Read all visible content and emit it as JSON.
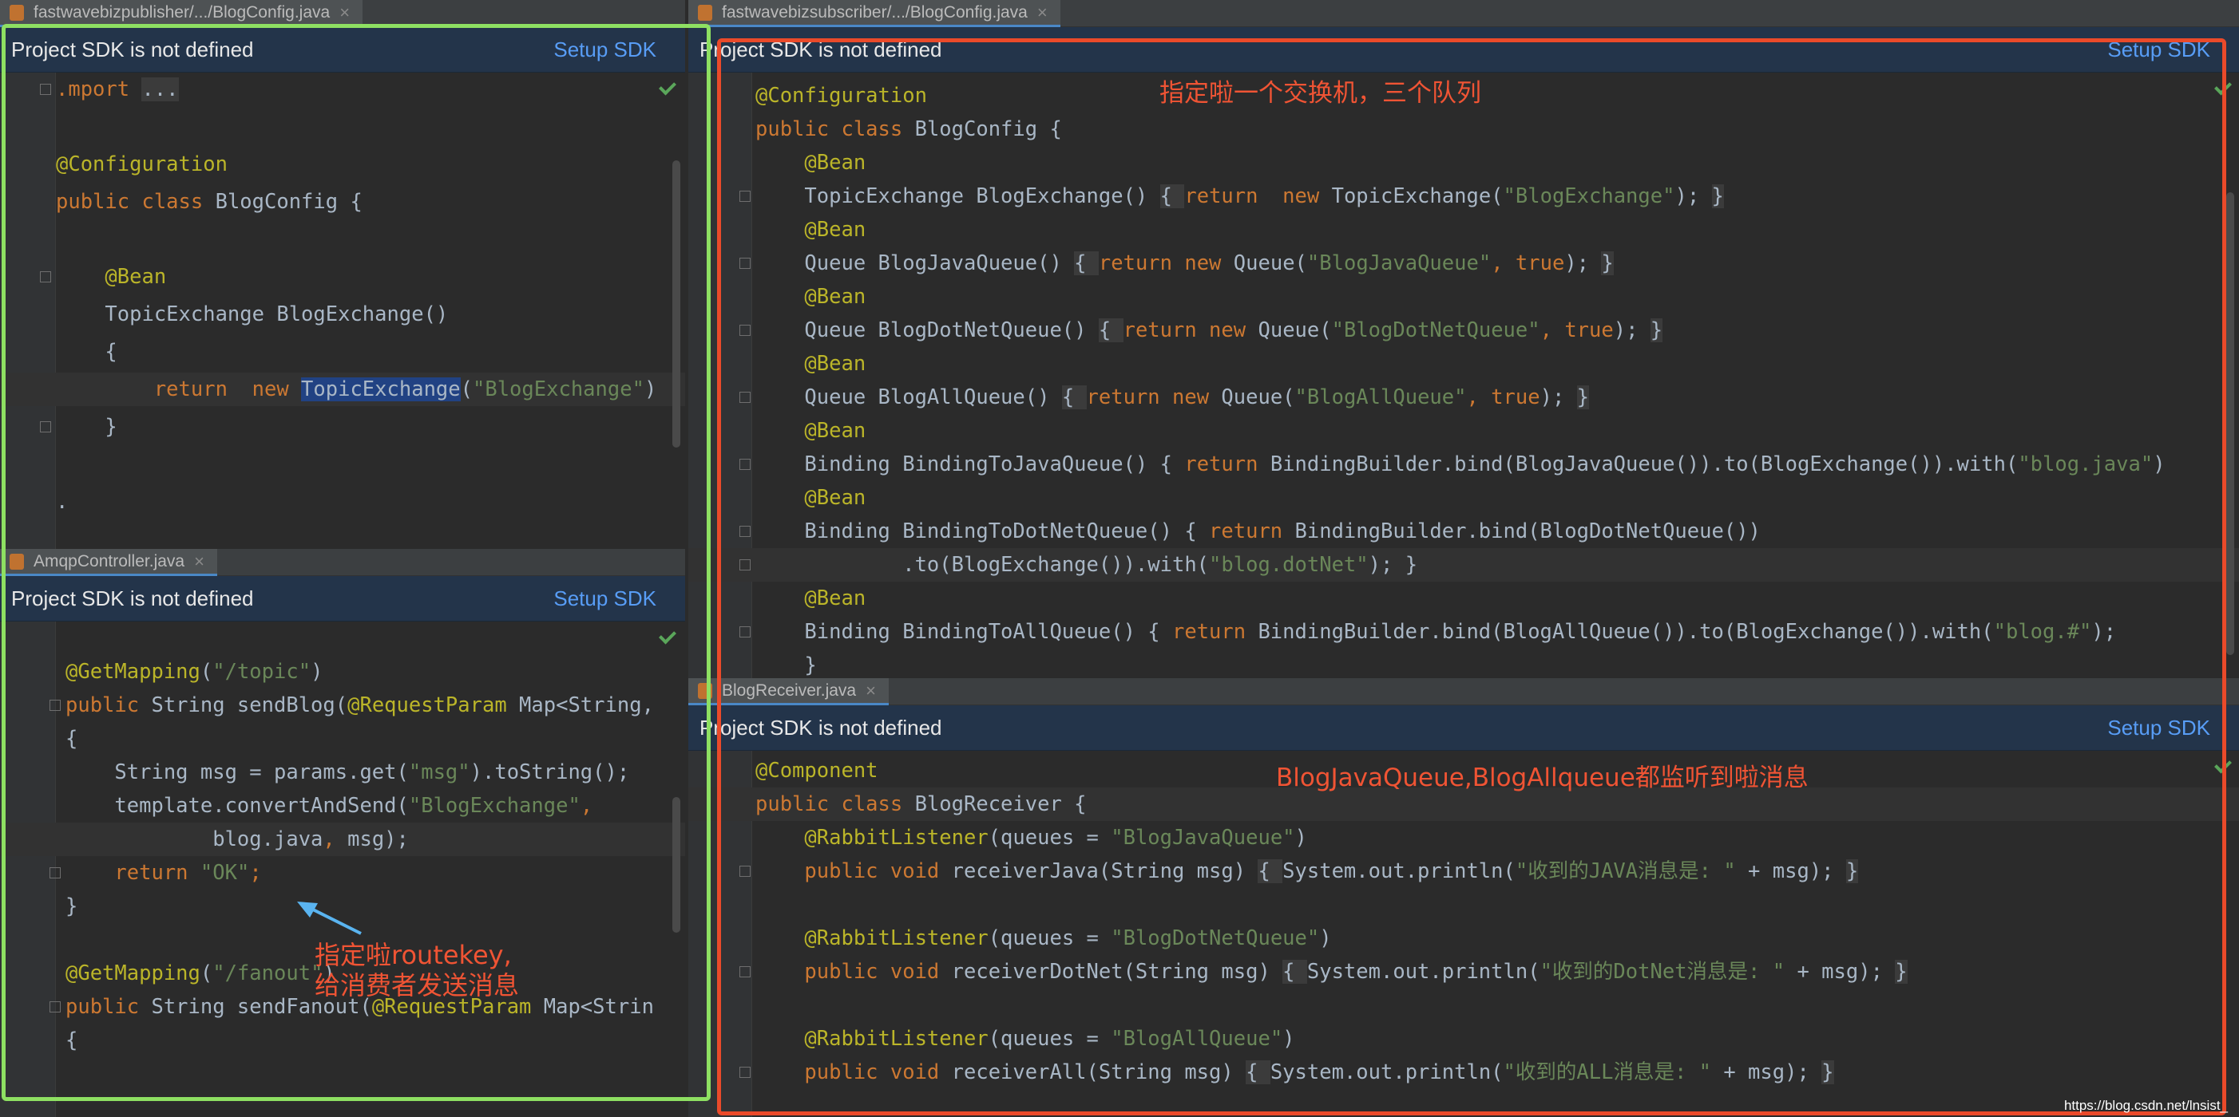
{
  "banner": {
    "message": "Project SDK is not defined",
    "action": "Setup SDK"
  },
  "panes": {
    "top_left": {
      "tab": "fastwavebizpublisher/.../BlogConfig.java",
      "lines": [
        {
          "t": [
            [
              "kw",
              ".mport "
            ],
            [
              "fb",
              "..."
            ]
          ]
        },
        {
          "t": []
        },
        {
          "t": [
            [
              "an",
              "@Configuration"
            ]
          ]
        },
        {
          "t": [
            [
              "kw",
              "public class "
            ],
            [
              "",
              "BlogConfig {"
            ]
          ]
        },
        {
          "t": []
        },
        {
          "t": [
            [
              "an",
              "    @Bean"
            ]
          ]
        },
        {
          "t": [
            [
              "",
              "    TopicExchange BlogExchange()"
            ]
          ]
        },
        {
          "t": [
            [
              "",
              "    {"
            ]
          ]
        },
        {
          "t": [
            [
              "kw",
              "        return  new "
            ],
            [
              "hl",
              "TopicExchange"
            ],
            [
              "",
              "("
            ],
            [
              "st",
              "\"BlogExchange\""
            ],
            [
              "",
              ")"
            ]
          ],
          "cur": true
        },
        {
          "t": [
            [
              "",
              "    }"
            ]
          ]
        },
        {
          "t": []
        },
        {
          "t": [
            [
              "",
              "."
            ]
          ]
        }
      ]
    },
    "bottom_left": {
      "tab": "AmqpController.java",
      "lines": [
        {
          "t": []
        },
        {
          "t": [
            [
              "an",
              "@GetMapping"
            ],
            [
              "",
              "("
            ],
            [
              "st",
              "\"/topic\""
            ],
            [
              "",
              ")"
            ]
          ]
        },
        {
          "t": [
            [
              "kw",
              "public "
            ],
            [
              "",
              "String sendBlog("
            ],
            [
              "an",
              "@RequestParam "
            ],
            [
              "",
              "Map<String,"
            ]
          ]
        },
        {
          "t": [
            [
              "",
              "{"
            ]
          ]
        },
        {
          "t": [
            [
              "",
              "    String msg = params.get("
            ],
            [
              "st",
              "\"msg\""
            ],
            [
              "",
              ").toString();"
            ]
          ]
        },
        {
          "t": [
            [
              "",
              "    template.convertAndSend("
            ],
            [
              "st",
              "\"BlogExchange\""
            ],
            [
              "kw",
              ","
            ]
          ]
        },
        {
          "t": [
            [
              "",
              "            blog.java"
            ],
            [
              "kw",
              ", "
            ],
            [
              "",
              "msg);"
            ]
          ],
          "cur": true
        },
        {
          "t": [
            [
              "kw",
              "    return "
            ],
            [
              "st",
              "\"OK\""
            ],
            [
              "kw",
              ";"
            ]
          ]
        },
        {
          "t": [
            [
              "",
              "}"
            ]
          ]
        },
        {
          "t": []
        },
        {
          "t": [
            [
              "an",
              "@GetMapping"
            ],
            [
              "",
              "("
            ],
            [
              "st",
              "\"/fanout\""
            ],
            [
              "",
              ")"
            ]
          ]
        },
        {
          "t": [
            [
              "kw",
              "public "
            ],
            [
              "",
              "String sendFanout("
            ],
            [
              "an",
              "@RequestParam "
            ],
            [
              "",
              "Map<Strin"
            ]
          ]
        },
        {
          "t": [
            [
              "",
              "{"
            ]
          ]
        }
      ]
    },
    "top_right": {
      "tab": "fastwavebizsubscriber/.../BlogConfig.java",
      "lines": [
        {
          "t": [
            [
              "an",
              "@Configuration"
            ]
          ]
        },
        {
          "t": [
            [
              "kw",
              "public class "
            ],
            [
              "",
              "BlogConfig {"
            ]
          ]
        },
        {
          "t": [
            [
              "an",
              "    @Bean"
            ]
          ]
        },
        {
          "t": [
            [
              "",
              "    TopicExchange BlogExchange() "
            ],
            [
              "fb",
              "{ "
            ],
            [
              "kw",
              "return  new "
            ],
            [
              "",
              "TopicExchange("
            ],
            [
              "st",
              "\"BlogExchange\""
            ],
            [
              "",
              "); "
            ],
            [
              "fb",
              "}"
            ]
          ]
        },
        {
          "t": [
            [
              "an",
              "    @Bean"
            ]
          ]
        },
        {
          "t": [
            [
              "",
              "    Queue BlogJavaQueue() "
            ],
            [
              "fb",
              "{ "
            ],
            [
              "kw",
              "return new "
            ],
            [
              "",
              "Queue("
            ],
            [
              "st",
              "\"BlogJavaQueue\""
            ],
            [
              "kw",
              ", true"
            ],
            [
              "",
              "); "
            ],
            [
              "fb",
              "}"
            ]
          ]
        },
        {
          "t": [
            [
              "an",
              "    @Bean"
            ]
          ]
        },
        {
          "t": [
            [
              "",
              "    Queue BlogDotNetQueue() "
            ],
            [
              "fb",
              "{ "
            ],
            [
              "kw",
              "return new "
            ],
            [
              "",
              "Queue("
            ],
            [
              "st",
              "\"BlogDotNetQueue\""
            ],
            [
              "kw",
              ", true"
            ],
            [
              "",
              "); "
            ],
            [
              "fb",
              "}"
            ]
          ]
        },
        {
          "t": [
            [
              "an",
              "    @Bean"
            ]
          ]
        },
        {
          "t": [
            [
              "",
              "    Queue BlogAllQueue() "
            ],
            [
              "fb",
              "{ "
            ],
            [
              "kw",
              "return new "
            ],
            [
              "",
              "Queue("
            ],
            [
              "st",
              "\"BlogAllQueue\""
            ],
            [
              "kw",
              ", true"
            ],
            [
              "",
              "); "
            ],
            [
              "fb",
              "}"
            ]
          ]
        },
        {
          "t": [
            [
              "an",
              "    @Bean"
            ]
          ]
        },
        {
          "t": [
            [
              "",
              "    Binding BindingToJavaQueue() { "
            ],
            [
              "kw",
              "return "
            ],
            [
              "",
              "BindingBuilder.bind(BlogJavaQueue()).to(BlogExchange()).with("
            ],
            [
              "st",
              "\"blog.java\""
            ],
            [
              "",
              ")"
            ]
          ]
        },
        {
          "t": [
            [
              "an",
              "    @Bean"
            ]
          ]
        },
        {
          "t": [
            [
              "",
              "    Binding BindingToDotNetQueue() { "
            ],
            [
              "kw",
              "return "
            ],
            [
              "",
              "BindingBuilder.bind(BlogDotNetQueue())"
            ]
          ]
        },
        {
          "t": [
            [
              "",
              "            .to(BlogExchange()).with("
            ],
            [
              "st",
              "\"blog.dotNet\""
            ],
            [
              "",
              "); }"
            ]
          ],
          "cur": true
        },
        {
          "t": [
            [
              "an",
              "    @Bean"
            ]
          ]
        },
        {
          "t": [
            [
              "",
              "    Binding BindingToAllQueue() { "
            ],
            [
              "kw",
              "return "
            ],
            [
              "",
              "BindingBuilder.bind(BlogAllQueue()).to(BlogExchange()).with("
            ],
            [
              "st",
              "\"blog.#\""
            ],
            [
              "",
              ");"
            ]
          ]
        },
        {
          "t": [
            [
              "",
              "    }"
            ]
          ]
        }
      ]
    },
    "bottom_right": {
      "tab": "BlogReceiver.java",
      "lines": [
        {
          "t": [
            [
              "an",
              "@Component"
            ]
          ]
        },
        {
          "t": [
            [
              "kw",
              "public class "
            ],
            [
              "",
              "BlogReceiver {"
            ]
          ],
          "cur": true
        },
        {
          "t": [
            [
              "an",
              "    @RabbitListener"
            ],
            [
              "",
              "(queues = "
            ],
            [
              "st",
              "\"BlogJavaQueue\""
            ],
            [
              "",
              ")"
            ]
          ]
        },
        {
          "t": [
            [
              "kw",
              "    public void "
            ],
            [
              "",
              "receiverJava(String msg) "
            ],
            [
              "fb",
              "{ "
            ],
            [
              "",
              "System.out.println("
            ],
            [
              "st",
              "\"收到的JAVA消息是: \""
            ],
            [
              "",
              " + msg); "
            ],
            [
              "fb",
              "}"
            ]
          ]
        },
        {
          "t": []
        },
        {
          "t": [
            [
              "an",
              "    @RabbitListener"
            ],
            [
              "",
              "(queues = "
            ],
            [
              "st",
              "\"BlogDotNetQueue\""
            ],
            [
              "",
              ")"
            ]
          ]
        },
        {
          "t": [
            [
              "kw",
              "    public void "
            ],
            [
              "",
              "receiverDotNet(String msg) "
            ],
            [
              "fb",
              "{ "
            ],
            [
              "",
              "System.out.println("
            ],
            [
              "st",
              "\"收到的DotNet消息是: \""
            ],
            [
              "",
              " + msg); "
            ],
            [
              "fb",
              "}"
            ]
          ]
        },
        {
          "t": []
        },
        {
          "t": [
            [
              "an",
              "    @RabbitListener"
            ],
            [
              "",
              "(queues = "
            ],
            [
              "st",
              "\"BlogAllQueue\""
            ],
            [
              "",
              ")"
            ]
          ]
        },
        {
          "t": [
            [
              "kw",
              "    public void "
            ],
            [
              "",
              "receiverAll(String msg) "
            ],
            [
              "fb",
              "{ "
            ],
            [
              "",
              "System.out.println("
            ],
            [
              "st",
              "\"收到的ALL消息是: \""
            ],
            [
              "",
              " + msg); "
            ],
            [
              "fb",
              "}"
            ]
          ]
        }
      ]
    }
  },
  "annotations": {
    "queues_note": "指定啦一个交换机，三个队列",
    "receiver_note": "BlogJavaQueue,BlogAllqueue都监听到啦消息",
    "routekey_note_line1": "指定啦routekey,",
    "routekey_note_line2": "给消费者发送消息"
  },
  "colors": {
    "left_frame": "#8ee062",
    "right_frame": "#ea4a2a",
    "note_text": "#f05434",
    "arrow": "#5ab4f0"
  },
  "watermark": "https://blog.csdn.net/lnsist_"
}
